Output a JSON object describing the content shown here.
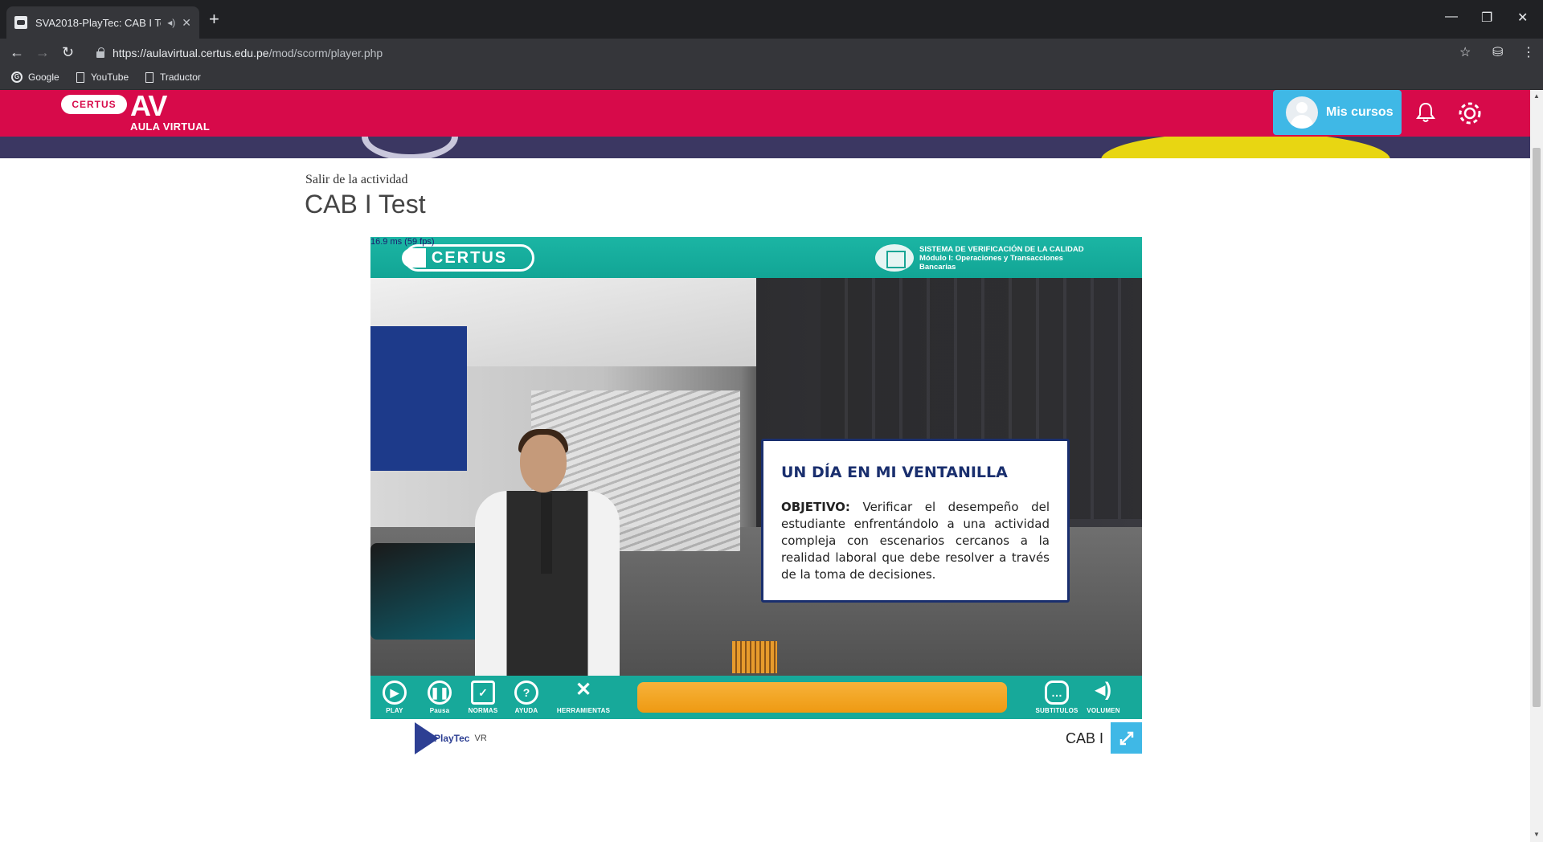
{
  "browser": {
    "tab_title": "SVA2018-PlayTec: CAB I Test",
    "audio_icon": "speaker-icon",
    "url_host": "https://aulavirtual.certus.edu.pe",
    "url_path": "/mod/scorm/player.php",
    "bookmarks": [
      {
        "label": "Google",
        "icon": "google-icon"
      },
      {
        "label": "YouTube",
        "icon": "page-icon"
      },
      {
        "label": "Traductor",
        "icon": "page-icon"
      }
    ]
  },
  "site": {
    "logo_pill": "CERTUS",
    "logo_av": "AV",
    "logo_sub": "AULA VIRTUAL",
    "mis_cursos": "Mis cursos",
    "accent": "#d70a4a",
    "button_color": "#3fb8e6"
  },
  "page": {
    "exit_link": "Salir de la actividad",
    "title": "CAB I Test"
  },
  "player": {
    "fps": "16.9 ms (59 fps)",
    "brand": "CERTUS",
    "sva_lines": [
      "SISTEMA DE VERIFICACIÓN DE LA CALIDAD",
      "Módulo I: Operaciones y Transacciones",
      "Bancarias"
    ],
    "dialog_title": "UN DÍA EN MI VENTANILLA",
    "dialog_label": "OBJETIVO:",
    "dialog_text": " Verificar el desempeño del estudiante enfrentándolo a una actividad compleja con escenarios cercanos a la realidad laboral que debe resolver a través de la toma de decisiones.",
    "controls": {
      "play": "PLAY",
      "pause": "Pausa",
      "rules": "NORMAS",
      "help": "AYUDA",
      "tools": "HERRAMIENTAS",
      "subtitles": "SUBTITULOS",
      "volume": "VOLUMEN"
    },
    "teal": "#17a99a",
    "progress_color": "#f3a322"
  },
  "footer": {
    "playtec": "PlayTec",
    "vr": "VR",
    "cab_label": "CAB I"
  }
}
